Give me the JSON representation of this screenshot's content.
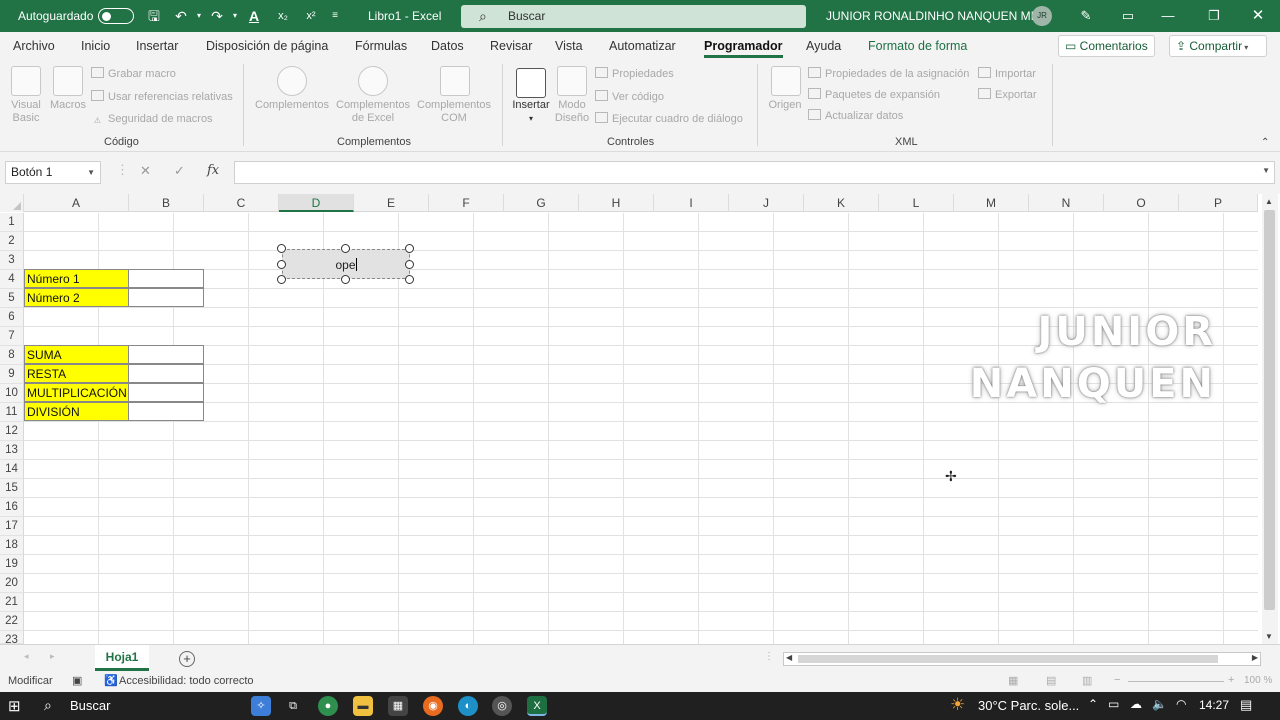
{
  "titlebar": {
    "autosave_label": "Autoguardado",
    "doc_title": "Libro1  -  Excel",
    "search_placeholder": "Buscar",
    "user_name": "JUNIOR RONALDINHO NANQUEN MIO",
    "user_initials": "JR"
  },
  "menu": {
    "items": [
      "Archivo",
      "Inicio",
      "Insertar",
      "Disposición de página",
      "Fórmulas",
      "Datos",
      "Revisar",
      "Vista",
      "Automatizar",
      "Programador",
      "Ayuda",
      "Formato de forma"
    ],
    "active": "Programador",
    "comments_label": "Comentarios",
    "share_label": "Compartir"
  },
  "ribbon": {
    "codigo": {
      "visual_basic": [
        "Visual",
        "Basic"
      ],
      "macros": "Macros",
      "grabar_macro": "Grabar macro",
      "usar_referencias": "Usar referencias relativas",
      "seguridad_macros": "Seguridad de macros",
      "group_label": "Código"
    },
    "complementos": {
      "complementos": "Complementos",
      "complementos_excel": [
        "Complementos",
        "de Excel"
      ],
      "complementos_com": [
        "Complementos",
        "COM"
      ],
      "group_label": "Complementos"
    },
    "controles": {
      "insertar": "Insertar",
      "modo_diseno": [
        "Modo",
        "Diseño"
      ],
      "propiedades": "Propiedades",
      "ver_codigo": "Ver código",
      "ejecutar_cuadro": "Ejecutar cuadro de diálogo",
      "group_label": "Controles"
    },
    "xml": {
      "origen": "Origen",
      "propiedades_asignacion": "Propiedades de la asignación",
      "paquetes_expansion": "Paquetes de expansión",
      "actualizar_datos": "Actualizar datos",
      "importar": "Importar",
      "exportar": "Exportar",
      "group_label": "XML"
    }
  },
  "formula_bar": {
    "name_box": "Botón 1",
    "fx": "fx",
    "formula": ""
  },
  "sheet": {
    "columns": [
      "A",
      "B",
      "C",
      "D",
      "E",
      "F",
      "G",
      "H",
      "I",
      "J",
      "K",
      "L",
      "M",
      "N",
      "O",
      "P"
    ],
    "selected_column": "D",
    "rows": [
      "1",
      "2",
      "3",
      "4",
      "5",
      "6",
      "7",
      "8",
      "9",
      "10",
      "11",
      "12",
      "13",
      "14",
      "15",
      "16",
      "17",
      "18",
      "19",
      "20",
      "21",
      "22",
      "23"
    ],
    "labels": {
      "numero1": "Número 1",
      "numero2": "Número 2",
      "suma": "SUMA",
      "resta": "RESTA",
      "multiplicacion": "MULTIPLICACIÓN",
      "division": "DIVISIÓN"
    },
    "button_text": "ope",
    "label_fill_color": "#FFFF00"
  },
  "watermark": [
    "JUNIOR",
    "NANQUEN"
  ],
  "tabs": {
    "sheet_name": "Hoja1",
    "add_icon": "+"
  },
  "status": {
    "mode": "Modificar",
    "accessibility": "Accesibilidad: todo correcto",
    "zoom": "100 %"
  },
  "taskbar": {
    "search": "Buscar",
    "weather": "30°C  Parc. sole...",
    "time": "14:27"
  },
  "colors": {
    "excel_green": "#217346",
    "taskbar": "#202020"
  }
}
